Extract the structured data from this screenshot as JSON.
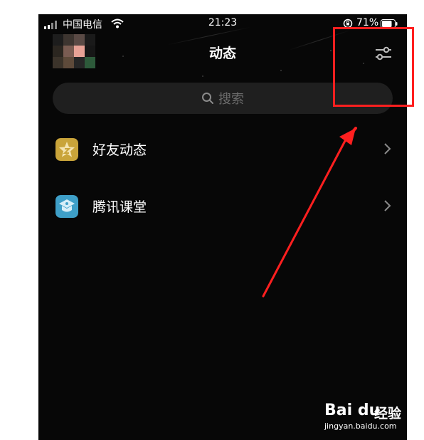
{
  "status_bar": {
    "carrier": "中国电信",
    "time": "21:23",
    "battery_percent": "71%"
  },
  "header": {
    "title": "动态",
    "filter_icon": "sliders-icon"
  },
  "search": {
    "placeholder": "搜索",
    "icon": "search-icon"
  },
  "list": {
    "items": [
      {
        "label": "好友动态",
        "icon": "friends-feed-icon",
        "icon_color": "#c9a43a"
      },
      {
        "label": "腾讯课堂",
        "icon": "tencent-classroom-icon",
        "icon_color": "#3e9fc8"
      }
    ]
  },
  "annotation": {
    "highlight_color": "#ff1f1f"
  },
  "watermark": {
    "brand": "Bai du",
    "suffix": "经验",
    "url": "jingyan.baidu.com"
  },
  "colors": {
    "background": "#070707",
    "search_bg": "#1f1f1f",
    "text": "#ffffff",
    "muted": "#6d6d6d"
  }
}
